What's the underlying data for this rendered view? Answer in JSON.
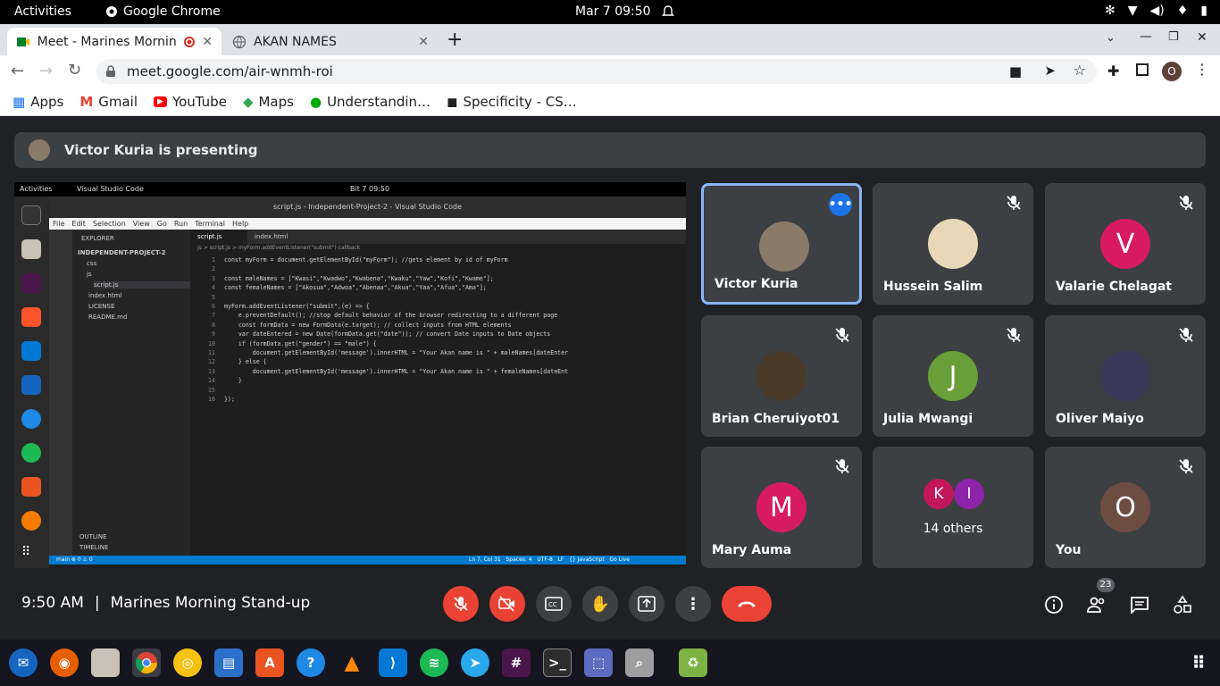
{
  "topbar": {
    "activities": "Activities",
    "app": "Google Chrome",
    "clock": "Mar 7  09:50"
  },
  "browser": {
    "tabs": [
      {
        "label": "Meet - Marines Mornin",
        "active": true
      },
      {
        "label": "AKAN NAMES",
        "active": false
      }
    ],
    "new_tab": "+",
    "url": "meet.google.com/air-wnmh-roi",
    "profile_letter": "O",
    "bookmarks": [
      "Apps",
      "Gmail",
      "YouTube",
      "Maps",
      "Understandin…",
      "Specificity - CS…"
    ]
  },
  "meet": {
    "presenting_banner": "Victor Kuria is presenting",
    "participants": [
      {
        "name": "Victor Kuria",
        "initial": "",
        "color": "#8a7a6a",
        "selected": true,
        "muted": false
      },
      {
        "name": "Hussein Salim",
        "initial": "",
        "color": "#e8d7b8",
        "selected": false,
        "muted": true
      },
      {
        "name": "Valarie Chelagat",
        "initial": "V",
        "color": "#d81b60",
        "selected": false,
        "muted": true
      },
      {
        "name": "Brian Cheruiyot01",
        "initial": "",
        "color": "#4a3a2a",
        "selected": false,
        "muted": true
      },
      {
        "name": "Julia Mwangi",
        "initial": "J",
        "color": "#689f38",
        "selected": false,
        "muted": true
      },
      {
        "name": "Oliver Maiyo",
        "initial": "",
        "color": "#3a3a5a",
        "selected": false,
        "muted": true
      },
      {
        "name": "Mary Auma",
        "initial": "M",
        "color": "#d81b60",
        "selected": false,
        "muted": true
      },
      {
        "name": "You",
        "initial": "O",
        "color": "#6d4c41",
        "selected": false,
        "muted": true
      }
    ],
    "others": {
      "label": "14 others",
      "initials": [
        "K",
        "I"
      ],
      "colors": [
        "#c2185b",
        "#8e24aa"
      ]
    },
    "time": "9:50 AM",
    "separator": "|",
    "meeting_title": "Marines Morning Stand-up",
    "people_count": "23"
  },
  "shared_screen": {
    "top_activities": "Activities",
    "top_app": "Visual Studio Code",
    "top_clock": "Bit 7  09:50",
    "window_title": "script.js - Independent-Project-2 - Visual Studio Code",
    "menu": [
      "File",
      "Edit",
      "Selection",
      "View",
      "Go",
      "Run",
      "Terminal",
      "Help"
    ],
    "explorer_title": "EXPLORER",
    "project": "INDEPENDENT-PROJECT-2",
    "files": [
      "css",
      "js",
      "script.js",
      "index.html",
      "LICENSE",
      "README.md"
    ],
    "outline": "OUTLINE",
    "timeline": "TIMELINE",
    "tabs": [
      "script.js",
      "index.html"
    ],
    "breadcrumb": "js > script.js > myForm.addEventListener(\"submit\") callback",
    "code": [
      {
        "n": "1",
        "t": "const myForm = document.getElementById(\"myForm\"); //gets element by id of myForm"
      },
      {
        "n": "2",
        "t": ""
      },
      {
        "n": "3",
        "t": "const maleNames = [\"Kwasi\",\"Kwadwo\",\"Kwabena\",\"Kwaku\",\"Yaw\",\"Kofi\",\"Kwame\"];"
      },
      {
        "n": "4",
        "t": "const femaleNames = [\"Akosua\",\"Adwoa\",\"Abenaa\",\"Akua\",\"Yaa\",\"Afua\",\"Ama\"];"
      },
      {
        "n": "5",
        "t": ""
      },
      {
        "n": "6",
        "t": "myForm.addEventListener(\"submit\",(e) => {"
      },
      {
        "n": "7",
        "t": "    e.preventDefault(); //stop default behavior of the browser redirecting to a different page"
      },
      {
        "n": "8",
        "t": "    const formData = new FormData(e.target); // collect inputs from HTML elements"
      },
      {
        "n": "9",
        "t": "    var dateEntered = new Date(formData.get(\"date\")); // convert Date inputs to Date objects"
      },
      {
        "n": "10",
        "t": "    if (formData.get(\"gender\") == \"male\") {"
      },
      {
        "n": "11",
        "t": "        document.getElementById('message').innerHTML = \"Your Akan name is \" + maleNames[dateEnter"
      },
      {
        "n": "12",
        "t": "    } else {"
      },
      {
        "n": "13",
        "t": "        document.getElementById('message').innerHTML = \"Your Akan name is \" + femaleNames[dateEnt"
      },
      {
        "n": "14",
        "t": "    }"
      },
      {
        "n": "15",
        "t": ""
      },
      {
        "n": "16",
        "t": "});"
      }
    ],
    "status_left": "main  ⊗ 0 ⚠ 0",
    "status_right": "Ln 7, Col 31   Spaces: 4   UTF-8   LF   {} JavaScript   Go Live"
  },
  "taskbar": {
    "apps": [
      "thunderbird",
      "firefox",
      "files",
      "chrome",
      "rhythmbox",
      "writer",
      "software",
      "help",
      "vlc",
      "vscode",
      "spotify",
      "telegram",
      "slack",
      "terminal",
      "screenshot",
      "image-viewer",
      "trash",
      "app-grid"
    ]
  }
}
